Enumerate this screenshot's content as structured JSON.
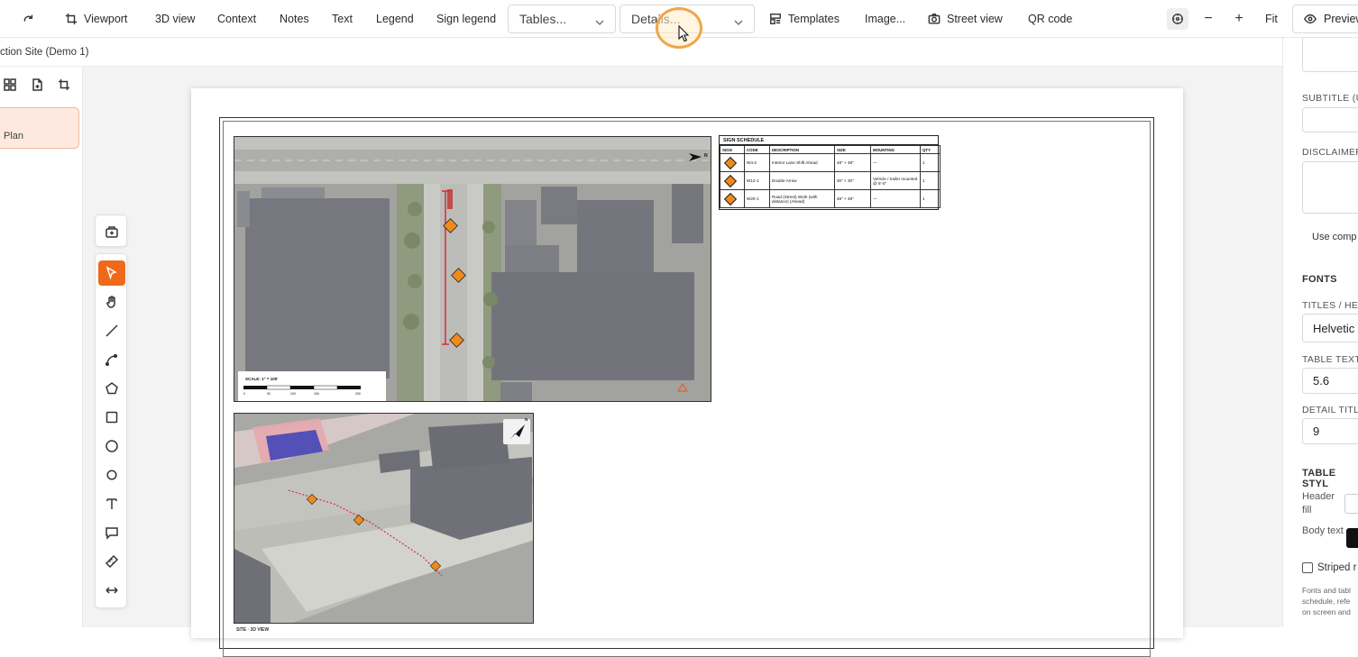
{
  "toolbar": {
    "redo_icon": "redo-icon",
    "viewport_label": "Viewport",
    "view3d_label": "3D view",
    "context_label": "Context",
    "notes_label": "Notes",
    "text_label": "Text",
    "legend_label": "Legend",
    "sign_legend_label": "Sign legend",
    "tables_select": "Tables...",
    "details_select": "Details...",
    "templates_label": "Templates",
    "image_label": "Image...",
    "street_view_label": "Street view",
    "qr_code_label": "QR code",
    "zoom_out": "−",
    "zoom_in": "+",
    "fit_label": "Fit",
    "preview_label": "Preview"
  },
  "subbar": {
    "project_title": "ction Site (Demo 1)"
  },
  "left_panel": {
    "plan_label": "Plan"
  },
  "sheet": {
    "map1": {
      "scale_label": "SCALE: 1\" = 100'",
      "scale_ticks": [
        "0",
        "50",
        "100",
        "150",
        "200"
      ],
      "north": "N"
    },
    "map2": {
      "north": "N"
    },
    "sign_schedule": {
      "title": "SIGN SCHEDULE",
      "headers": [
        "SIGN",
        "CODE",
        "DESCRIPTION",
        "SIZE",
        "MOUNTING",
        "QTY"
      ],
      "rows": [
        {
          "code": "W4-2",
          "description": "Interior Lane Shift Ahead",
          "size": "48\" × 48\"",
          "mounting": "—",
          "qty": "1"
        },
        {
          "code": "W12-1",
          "description": "Double Arrow",
          "size": "30\" × 30\"",
          "mounting": "Vehicle / trailer mounted @ 5'-0\"",
          "qty": "1"
        },
        {
          "code": "W20-1",
          "description": "Road (Street) Work (with distance) (Ahead)",
          "size": "48\" × 48\"",
          "mounting": "—",
          "qty": "1"
        }
      ]
    },
    "caption": "SITE · 3D VIEW"
  },
  "right_panel": {
    "subtitle_label": "SUBTITLE (U",
    "disclaimer_label": "DISCLAIMER",
    "use_comp_label": "Use comp",
    "fonts_heading": "FONTS",
    "titles_label": "TITLES / HEA",
    "titles_font": "Helvetic",
    "table_text_label": "TABLE TEXT",
    "table_text_value": "5.6",
    "detail_title_label": "DETAIL TITL",
    "detail_title_value": "9",
    "table_style_heading": "TABLE STYL",
    "header_fill_label": "Header fill",
    "body_text_label": "Body text",
    "striped_label": "Striped r",
    "note_line1": "Fonts and tabl",
    "note_line2": "schedule, refe",
    "note_line3": "on screen and"
  },
  "colors": {
    "accent": "#ee6a1a",
    "sign_orange": "#f08a1c",
    "measure_red": "#d9222a"
  }
}
